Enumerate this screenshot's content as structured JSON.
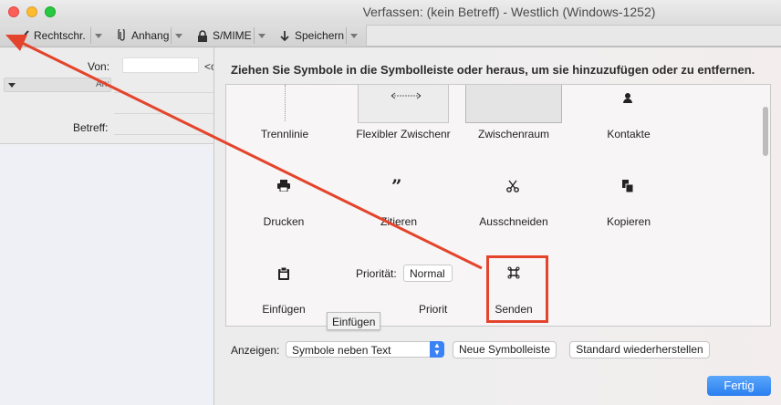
{
  "window": {
    "title": "Verfassen: (kein Betreff) - Westlich (Windows-1252)"
  },
  "toolbar": {
    "spellcheck_label": "Rechtschr.",
    "attach_label": "Anhang",
    "smime_label": "S/MIME",
    "save_label": "Speichern"
  },
  "compose": {
    "from_label": "Von:",
    "from_tail": "<c",
    "addr_type": "An:",
    "subject_label": "Betreff:"
  },
  "customize": {
    "heading": "Ziehen Sie Symbole in die Symbolleiste oder heraus, um sie hinzuzufügen oder zu entfernen.",
    "items": {
      "separator": "Trennlinie",
      "flex_space": "Flexibler Zwischenr",
      "space": "Zwischenraum",
      "contacts": "Kontakte",
      "print": "Drucken",
      "quote": "Zitieren",
      "cut": "Ausschneiden",
      "copy": "Kopieren",
      "paste": "Einfügen",
      "priority_short": "Priorit",
      "send": "Senden"
    },
    "priority_label": "Priorität:",
    "priority_value": "Normal",
    "tooltip": "Einfügen",
    "show_label": "Anzeigen:",
    "show_value": "Symbole neben Text",
    "new_toolbar_button": "Neue Symbolleiste",
    "restore_default_button": "Standard wiederherstellen",
    "done_button": "Fertig"
  },
  "colors": {
    "annotation_red": "#e4442b",
    "accent_blue": "#2a7ef0"
  }
}
